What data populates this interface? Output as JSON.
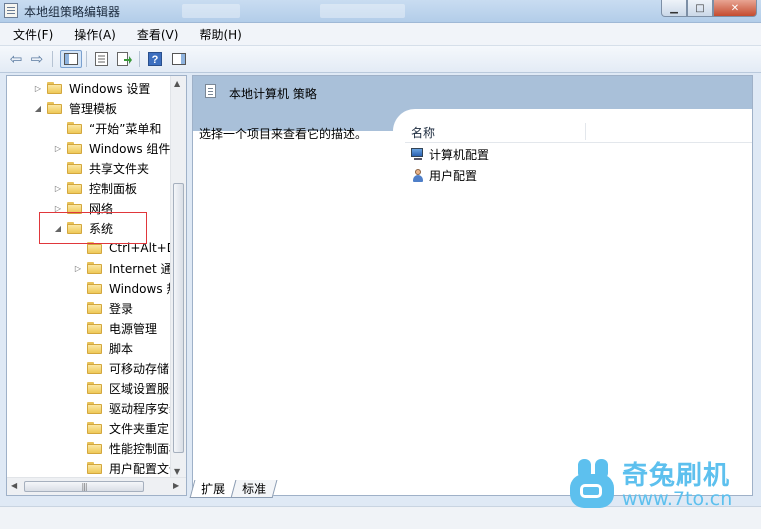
{
  "window": {
    "title": "本地组策略编辑器",
    "minimize_label": "▁",
    "maximize_label": "□",
    "close_label": "✕"
  },
  "menu": [
    "文件(F)",
    "操作(A)",
    "查看(V)",
    "帮助(H)"
  ],
  "toolbar": {
    "icons": [
      "back-arrow-icon",
      "forward-arrow-icon",
      "show-hide-tree-icon",
      "properties-icon",
      "export-list-icon",
      "help-icon",
      "show-hide-action-pane-icon"
    ],
    "back_glyph": "⇦",
    "forward_glyph": "⇨",
    "help_glyph": "?"
  },
  "tree": [
    {
      "label": "Windows 设置",
      "level": 1,
      "twisty": "▷"
    },
    {
      "label": "管理模板",
      "level": 1,
      "twisty": "◢"
    },
    {
      "label": "“开始”菜单和",
      "level": 2,
      "twisty": ""
    },
    {
      "label": "Windows 组件",
      "level": 2,
      "twisty": "▷"
    },
    {
      "label": "共享文件夹",
      "level": 2,
      "twisty": ""
    },
    {
      "label": "控制面板",
      "level": 2,
      "twisty": "▷"
    },
    {
      "label": "网络",
      "level": 2,
      "twisty": "▷"
    },
    {
      "label": "系统",
      "level": 2,
      "twisty": "◢"
    },
    {
      "label": "Ctrl+Alt+De",
      "level": 3,
      "twisty": ""
    },
    {
      "label": "Internet 通",
      "level": 3,
      "twisty": "▷"
    },
    {
      "label": "Windows 热",
      "level": 3,
      "twisty": ""
    },
    {
      "label": "登录",
      "level": 3,
      "twisty": ""
    },
    {
      "label": "电源管理",
      "level": 3,
      "twisty": ""
    },
    {
      "label": "脚本",
      "level": 3,
      "twisty": ""
    },
    {
      "label": "可移动存储",
      "level": 3,
      "twisty": ""
    },
    {
      "label": "区域设置服务",
      "level": 3,
      "twisty": ""
    },
    {
      "label": "驱动程序安装",
      "level": 3,
      "twisty": ""
    },
    {
      "label": "文件夹重定向",
      "level": 3,
      "twisty": ""
    },
    {
      "label": "性能控制面板",
      "level": 3,
      "twisty": ""
    },
    {
      "label": "用户配置文件",
      "level": 3,
      "twisty": ""
    }
  ],
  "tree_scroll": {
    "up": "▲",
    "down": "▼",
    "left": "◀",
    "right": "▶",
    "grip": "|||"
  },
  "right_panel": {
    "title": "本地计算机 策略",
    "description": "选择一个项目来查看它的描述。",
    "column_name": "名称",
    "items": [
      {
        "label": "计算机配置",
        "icon": "computer-config-icon"
      },
      {
        "label": "用户配置",
        "icon": "user-config-icon"
      }
    ]
  },
  "tabs": [
    "扩展",
    "标准"
  ],
  "watermark": {
    "brand": "奇兔刷机",
    "url": "www.7to.cn"
  },
  "colors": {
    "header_bg": "#a9c0d9",
    "highlight_border": "#e0373b",
    "watermark": "#5dc0ee"
  }
}
